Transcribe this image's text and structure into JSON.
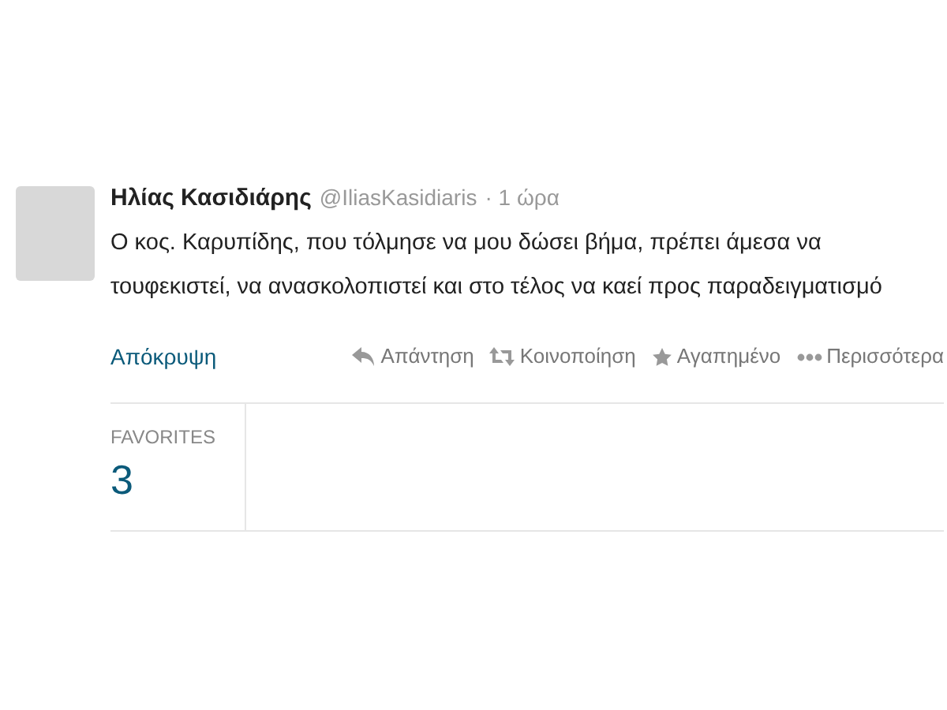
{
  "tweet": {
    "name": "Ηλίας Κασιδιάρης",
    "handle": "@IliasKasidiaris",
    "time": "· 1 ώρα",
    "text": "Ο κος. Καρυπίδης, που τόλμησε να μου δώσει βήμα, πρέπει άμεσα να τουφεκιστεί, να ανασκολοπιστεί και στο τέλος να καεί προς παραδειγματισμό",
    "hide_link": "Απόκρυψη",
    "actions": [
      {
        "kind": "reply",
        "label": "Απάντηση"
      },
      {
        "kind": "retweet",
        "label": "Κοινοποίηση"
      },
      {
        "kind": "favorite",
        "label": "Αγαπημένο"
      },
      {
        "kind": "more",
        "label": "Περισσότερα"
      }
    ],
    "stats": [
      {
        "label": "FAVORITES",
        "value": "3"
      }
    ]
  }
}
